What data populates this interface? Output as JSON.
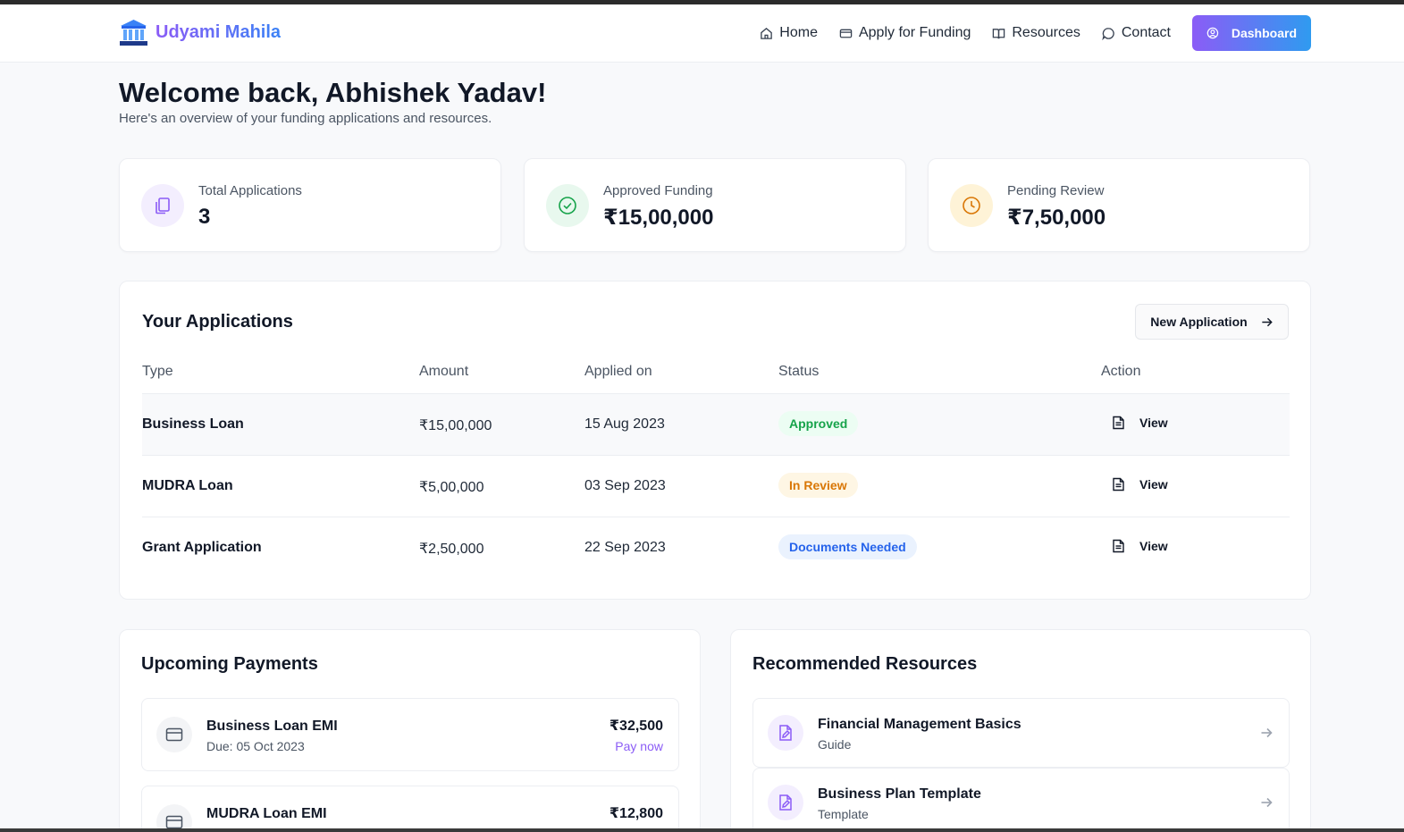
{
  "brand": {
    "name": "Udyami Mahila"
  },
  "nav": {
    "items": [
      {
        "label": "Home",
        "icon": "home-icon"
      },
      {
        "label": "Apply for Funding",
        "icon": "credit-card-icon"
      },
      {
        "label": "Resources",
        "icon": "book-icon"
      },
      {
        "label": "Contact",
        "icon": "chat-icon"
      }
    ],
    "dashboard_label": "Dashboard"
  },
  "welcome": {
    "title": "Welcome back, Abhishek Yadav!",
    "subtitle": "Here's an overview of your funding applications and resources."
  },
  "stats": [
    {
      "label": "Total Applications",
      "value": "3",
      "icon": "documents-icon",
      "color": "#8b5cf6"
    },
    {
      "label": "Approved Funding",
      "value": "₹15,00,000",
      "icon": "check-circle-icon",
      "color": "#16a34a"
    },
    {
      "label": "Pending Review",
      "value": "₹7,50,000",
      "icon": "clock-icon",
      "color": "#d97706"
    }
  ],
  "applications": {
    "title": "Your Applications",
    "new_button": "New Application",
    "columns": [
      "Type",
      "Amount",
      "Applied on",
      "Status",
      "Action"
    ],
    "rows": [
      {
        "type": "Business Loan",
        "amount": "₹15,00,000",
        "date": "15 Aug 2023",
        "status": "Approved",
        "action": "View"
      },
      {
        "type": "MUDRA Loan",
        "amount": "₹5,00,000",
        "date": "03 Sep 2023",
        "status": "In Review",
        "action": "View"
      },
      {
        "type": "Grant Application",
        "amount": "₹2,50,000",
        "date": "22 Sep 2023",
        "status": "Documents Needed",
        "action": "View"
      }
    ]
  },
  "payments": {
    "title": "Upcoming Payments",
    "items": [
      {
        "name": "Business Loan EMI",
        "due": "Due: 05 Oct 2023",
        "amount": "₹32,500",
        "action": "Pay now"
      },
      {
        "name": "MUDRA Loan EMI",
        "amount": "₹12,800"
      }
    ]
  },
  "resources": {
    "title": "Recommended Resources",
    "items": [
      {
        "title": "Financial Management Basics",
        "type": "Guide"
      },
      {
        "title": "Business Plan Template",
        "type": "Template"
      }
    ]
  }
}
